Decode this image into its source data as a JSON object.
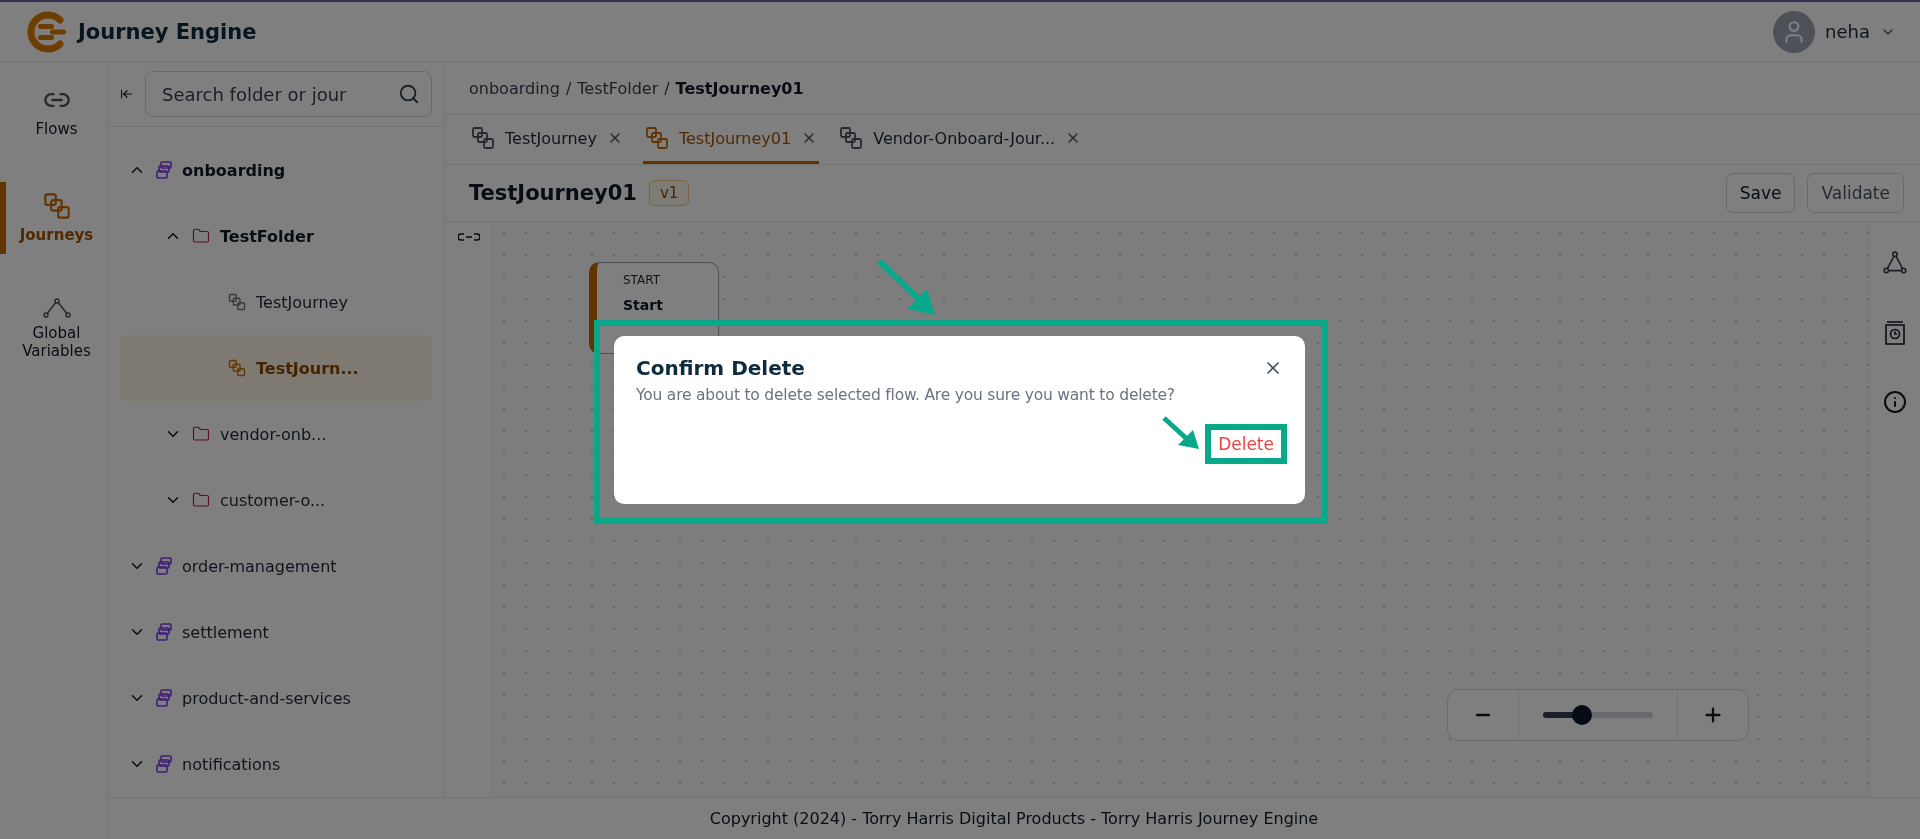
{
  "app": {
    "title": "Journey Engine",
    "user": "neha"
  },
  "nav": [
    {
      "label": "Flows",
      "kind": "flows",
      "selected": false
    },
    {
      "label": "Journeys",
      "kind": "journeys",
      "selected": true
    },
    {
      "label": "Global Variables",
      "kind": "variables",
      "selected": false
    }
  ],
  "tree": {
    "search_placeholder": "Search folder or jour",
    "items": [
      {
        "label": "onboarding",
        "kind": "project",
        "expanded": true,
        "selected": false,
        "children": [
          {
            "label": "TestFolder",
            "kind": "folder",
            "expanded": true,
            "selected": false,
            "children": [
              {
                "label": "TestJourney",
                "kind": "journey",
                "selected": false
              },
              {
                "label": "TestJourn...",
                "kind": "journey",
                "selected": true
              }
            ]
          },
          {
            "label": "vendor-onb...",
            "kind": "folder",
            "expanded": false,
            "selected": false
          },
          {
            "label": "customer-o...",
            "kind": "folder",
            "expanded": false,
            "selected": false
          }
        ]
      },
      {
        "label": "order-management",
        "kind": "project",
        "expanded": false,
        "selected": false
      },
      {
        "label": "settlement",
        "kind": "project",
        "expanded": false,
        "selected": false
      },
      {
        "label": "product-and-services",
        "kind": "project",
        "expanded": false,
        "selected": false
      },
      {
        "label": "notifications",
        "kind": "project",
        "expanded": false,
        "selected": false
      }
    ]
  },
  "breadcrumb": {
    "separator": "/",
    "items": [
      "onboarding",
      "TestFolder",
      "TestJourney01"
    ]
  },
  "tabs": [
    {
      "label": "TestJourney",
      "selected": false
    },
    {
      "label": "TestJourney01",
      "selected": true
    },
    {
      "label": "Vendor-Onboard-Jour...",
      "selected": false
    }
  ],
  "journey": {
    "title": "TestJourney01",
    "version": "v1"
  },
  "actions": [
    {
      "label": "Save",
      "disabled": false
    },
    {
      "label": "Validate",
      "disabled": true
    }
  ],
  "canvas": {
    "node": {
      "type": "START",
      "name": "Start"
    },
    "zoom": {
      "level": 0.35
    }
  },
  "dialog": {
    "title": "Confirm Delete",
    "message": "You are about to delete selected flow. Are you sure you want to delete?",
    "confirm": "Delete"
  },
  "footer": "Copyright (2024) - Torry Harris Digital Products - Torry Harris Journey Engine"
}
